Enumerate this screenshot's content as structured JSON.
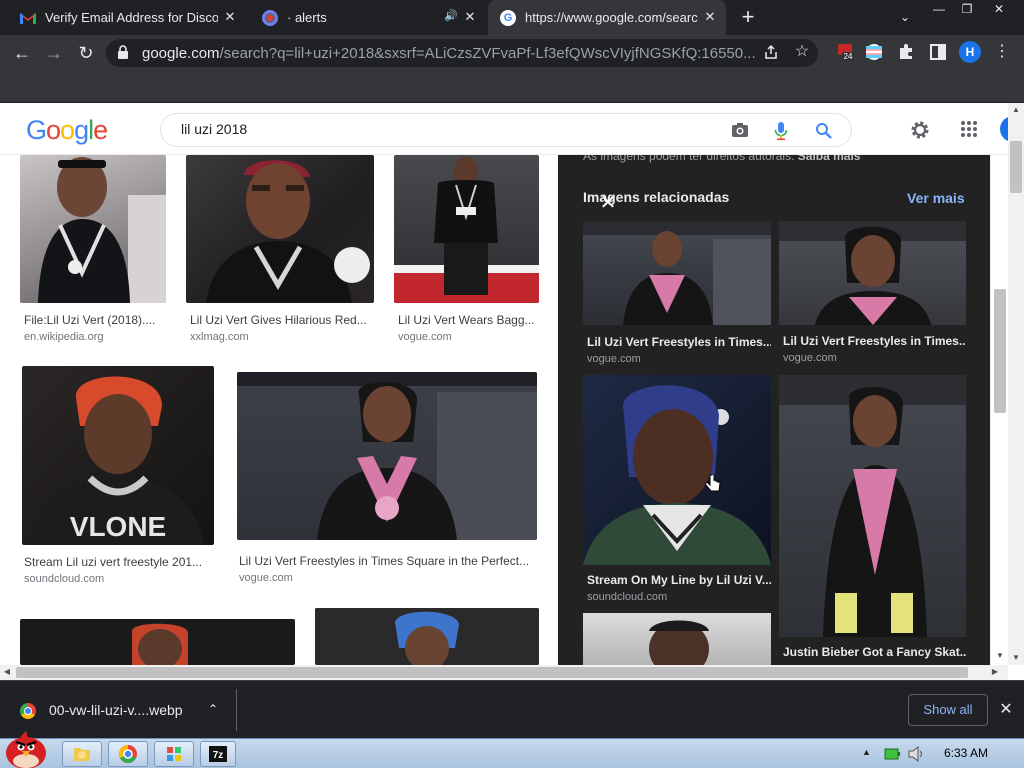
{
  "browser": {
    "tabs": [
      {
        "title": "Verify Email Address for Disco",
        "icon": "gmail-icon",
        "close": "✕"
      },
      {
        "title": "· alerts",
        "icon": "alerts-site-icon",
        "close": "✕",
        "audio": "🔊"
      },
      {
        "title": "https://www.google.com/searc",
        "icon": "google-icon",
        "close": "✕"
      }
    ],
    "newtab_glyph": "+",
    "tabsearch_glyph": "⌄",
    "window_buttons": {
      "min": "—",
      "restore": "❐",
      "close": "✕"
    },
    "url_host": "google.com",
    "url_rest": "/search?q=lil+uzi+2018&sxsrf=ALiCzsZVFvaPf-Lf3efQWscVIyjfNGSKfQ:16550...",
    "profile_initial": "H",
    "extension_badge": "24",
    "nav": {
      "back": "←",
      "forward": "→",
      "reload": "↻"
    }
  },
  "google": {
    "logo": [
      "G",
      "o",
      "o",
      "g",
      "l",
      "e"
    ],
    "logo_colors": [
      "#4285f4",
      "#ea4335",
      "#fbbc05",
      "#4285f4",
      "#34a853",
      "#ea4335"
    ],
    "query": "lil uzi 2018"
  },
  "results": [
    {
      "caption": "File:Lil Uzi Vert (2018)....",
      "source": "en.wikipedia.org"
    },
    {
      "caption": "Lil Uzi Vert Gives Hilarious Red...",
      "source": "xxlmag.com"
    },
    {
      "caption": "Lil Uzi Vert Wears Bagg...",
      "source": "vogue.com"
    },
    {
      "caption": "Stream Lil uzi vert freestyle 201...",
      "source": "soundcloud.com"
    },
    {
      "caption": "Lil Uzi Vert Freestyles in Times Square in the Perfect...",
      "source": "vogue.com"
    }
  ],
  "panel": {
    "notice_text": "As imagens podem ter direitos autorais.",
    "notice_link": "Saiba mais",
    "close_glyph": "✕",
    "related_heading": "Imagens relacionadas",
    "ver_mais": "Ver mais",
    "related": [
      {
        "caption": "Lil Uzi Vert Freestyles in Times...",
        "source": "vogue.com"
      },
      {
        "caption": "Lil Uzi Vert Freestyles in Times...",
        "source": "vogue.com"
      },
      {
        "caption": "Stream On My Line by Lil Uzi V...",
        "source": "soundcloud.com"
      },
      {
        "caption": "Justin Bieber Got a Fancy Skat...",
        "source": ""
      }
    ]
  },
  "downloads": {
    "filename": "00-vw-lil-uzi-v....webp",
    "chevron": "⌃",
    "show_all": "Show all",
    "close_glyph": "✕"
  },
  "taskbar": {
    "clock": "6:33 AM"
  }
}
